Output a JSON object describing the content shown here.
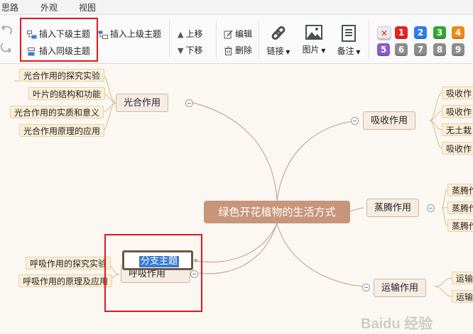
{
  "tabs": [
    "思路",
    "外观",
    "视图"
  ],
  "toolbar": {
    "insert_child": "插入下级主题",
    "insert_parent": "插入上级主题",
    "insert_sibling": "插入同级主题",
    "move_up": "上移",
    "move_down": "下移",
    "edit": "编辑",
    "delete": "删除",
    "link": "链接",
    "image": "图片",
    "note": "备注",
    "priorities_row1": [
      "✕",
      "1",
      "2",
      "3",
      "4"
    ],
    "priorities_row2": [
      "5",
      "6",
      "7",
      "8",
      "9"
    ]
  },
  "colors": {
    "priority": [
      "#e9e9e9",
      "#e42323",
      "#2f7fe8",
      "#33a733",
      "#f08a17",
      "#8a5ad8",
      "#8d8d8d",
      "#8d8d8d",
      "#8d8d8d",
      "#8d8d8d"
    ],
    "central": "#c7957a",
    "branch_line": "#c9a898",
    "highlight": "#e8141b"
  },
  "mindmap": {
    "central": "绿色开花植物的生活方式",
    "branches": {
      "photosynthesis": {
        "label": "光合作用",
        "leaves": [
          "光合作用的探究实验",
          "叶片的结构和功能",
          "光合作用的实质和意义",
          "光合作用原理的应用"
        ]
      },
      "absorption": {
        "label": "吸收作用",
        "leaves": [
          "吸收作",
          "吸收作",
          "无土栽",
          "吸收作"
        ]
      },
      "transpiration": {
        "label": "蒸腾作用",
        "leaves": [
          "蒸腾作",
          "蒸腾作",
          "蒸腾作"
        ]
      },
      "respiration": {
        "label": "呼吸作用",
        "leaves": [
          "呼吸作用的探究实验",
          "呼吸作用的原理及应用"
        ]
      },
      "transport": {
        "label": "运输作用",
        "leaves": [
          "运输",
          "运输"
        ]
      }
    },
    "editing_node": "分支主题"
  },
  "watermark": "Baidu 经验"
}
